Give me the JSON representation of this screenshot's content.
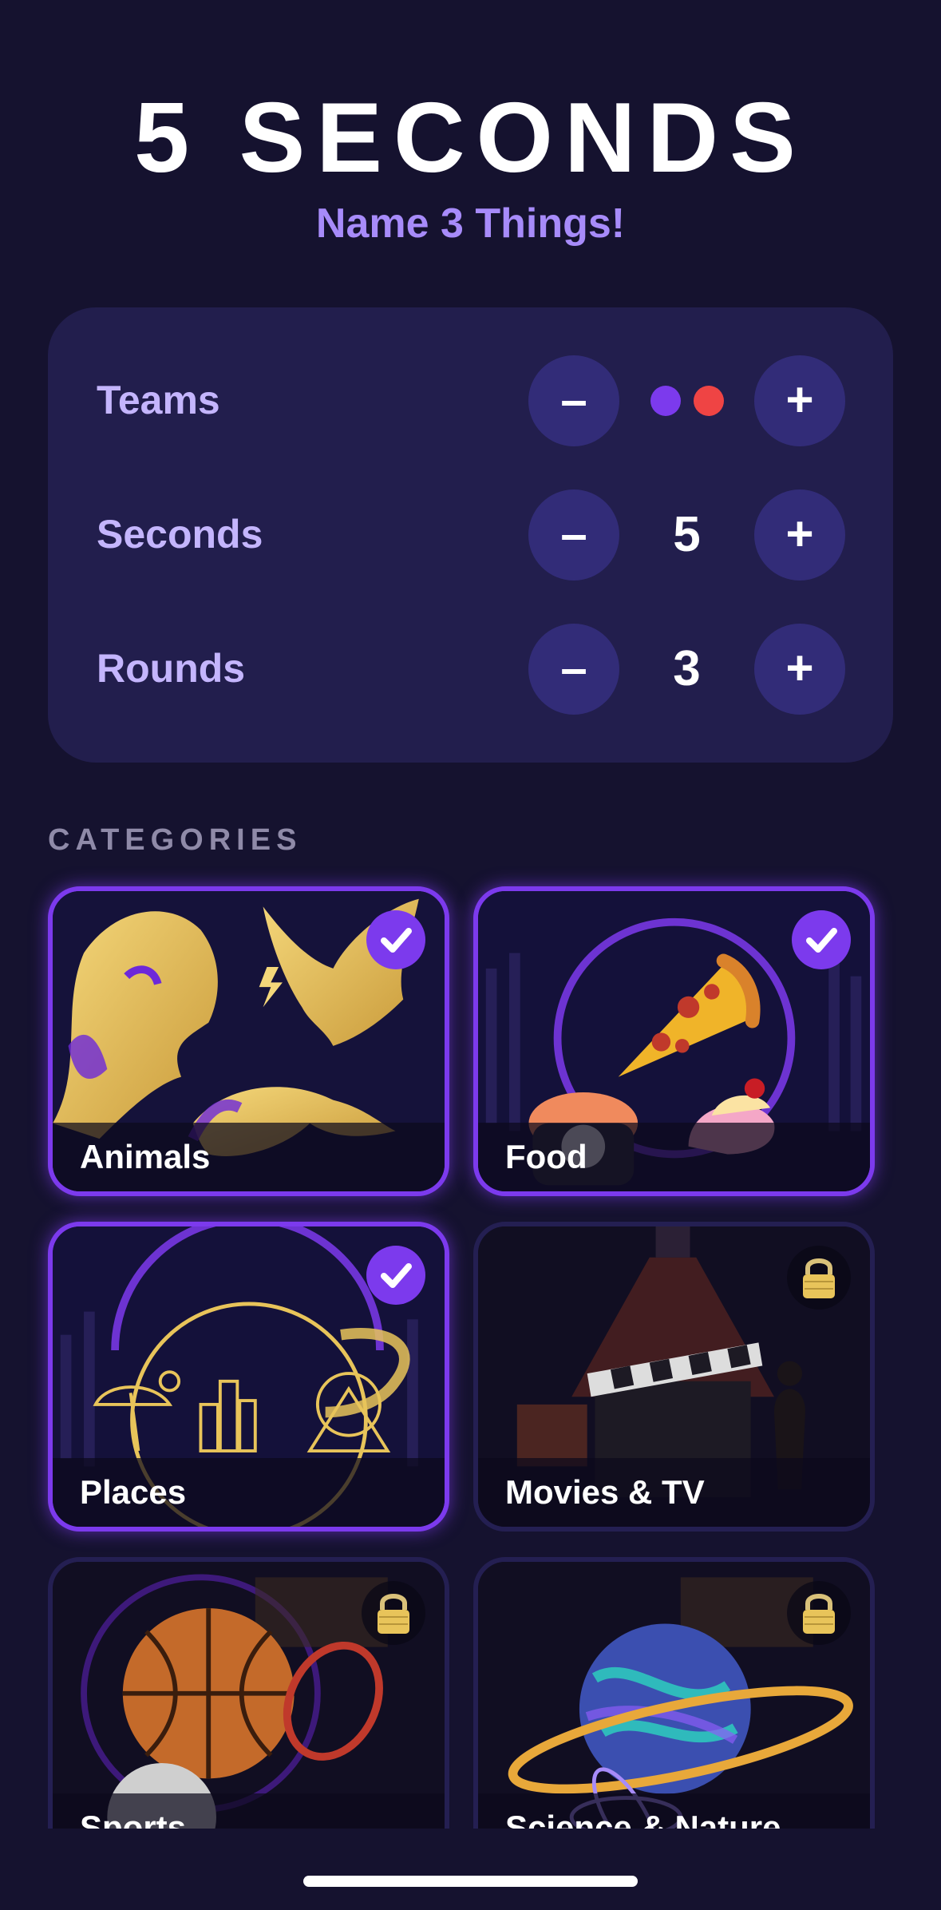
{
  "app": {
    "title": "5 SECONDS",
    "subtitle": "Name 3 Things!"
  },
  "settings": {
    "teams": {
      "label": "Teams",
      "minus": "–",
      "plus": "+",
      "team_colors": [
        "#7c3aed",
        "#ef4444"
      ]
    },
    "seconds": {
      "label": "Seconds",
      "value": "5",
      "minus": "–",
      "plus": "+"
    },
    "rounds": {
      "label": "Rounds",
      "value": "3",
      "minus": "–",
      "plus": "+"
    }
  },
  "categories": {
    "heading": "CATEGORIES",
    "items": [
      {
        "label": "Animals",
        "selected": true,
        "locked": false,
        "icon": "checkmark-icon"
      },
      {
        "label": "Food",
        "selected": true,
        "locked": false,
        "icon": "checkmark-icon"
      },
      {
        "label": "Places",
        "selected": true,
        "locked": false,
        "icon": "checkmark-icon"
      },
      {
        "label": "Movies & TV",
        "selected": false,
        "locked": true,
        "icon": "lock-icon"
      },
      {
        "label": "Sports",
        "selected": false,
        "locked": true,
        "icon": "lock-icon"
      },
      {
        "label": "Science & Nature",
        "selected": false,
        "locked": true,
        "icon": "lock-icon"
      }
    ]
  },
  "colors": {
    "background": "#15122f",
    "card": "#221e4d",
    "stepper_button": "#322c78",
    "accent": "#7c3aed",
    "label": "#c4b5fd",
    "subtitle": "#a78bfa",
    "gold": "#e8c45a"
  }
}
